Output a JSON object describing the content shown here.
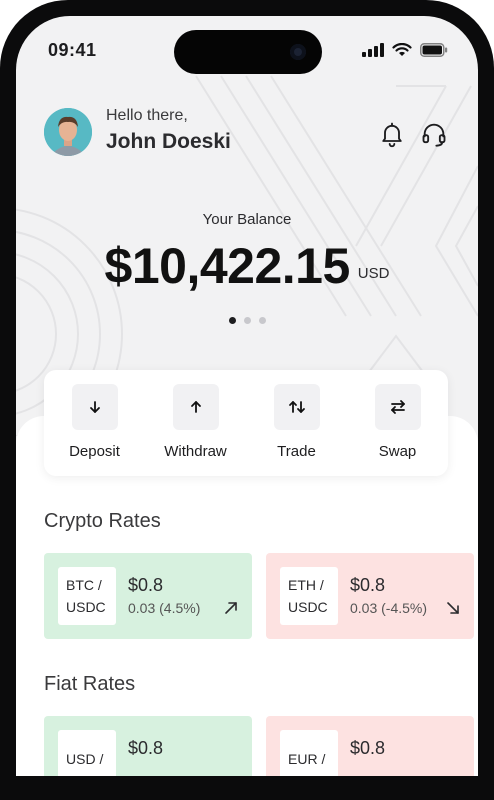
{
  "status_bar": {
    "time": "09:41"
  },
  "header": {
    "greeting": "Hello there,",
    "user_name": "John Doeski",
    "icons": [
      "bell-icon",
      "headset-icon"
    ]
  },
  "balance": {
    "label": "Your Balance",
    "amount": "$10,422.15",
    "currency": "USD",
    "carousel_pages": 3,
    "active_page": 1
  },
  "actions": [
    {
      "label": "Deposit",
      "icon": "arrow-down-icon"
    },
    {
      "label": "Withdraw",
      "icon": "arrow-up-icon"
    },
    {
      "label": "Trade",
      "icon": "up-down-arrows-icon"
    },
    {
      "label": "Swap",
      "icon": "swap-arrows-icon"
    }
  ],
  "crypto_rates": {
    "title": "Crypto Rates",
    "items": [
      {
        "base": "BTC /",
        "quote": "USDC",
        "price": "$0.8",
        "change": "0.03 (4.5%)",
        "trend": "up"
      },
      {
        "base": "ETH /",
        "quote": "USDC",
        "price": "$0.8",
        "change": "0.03 (-4.5%)",
        "trend": "down"
      }
    ]
  },
  "fiat_rates": {
    "title": "Fiat Rates",
    "items": [
      {
        "base": "USD /",
        "price": "$0.8",
        "trend": "up"
      },
      {
        "base": "EUR /",
        "price": "$0.8",
        "trend": "down"
      }
    ]
  },
  "colors": {
    "up_card": "#d7f1df",
    "down_card": "#fde2e1",
    "text_dark": "#1d1d1f"
  }
}
